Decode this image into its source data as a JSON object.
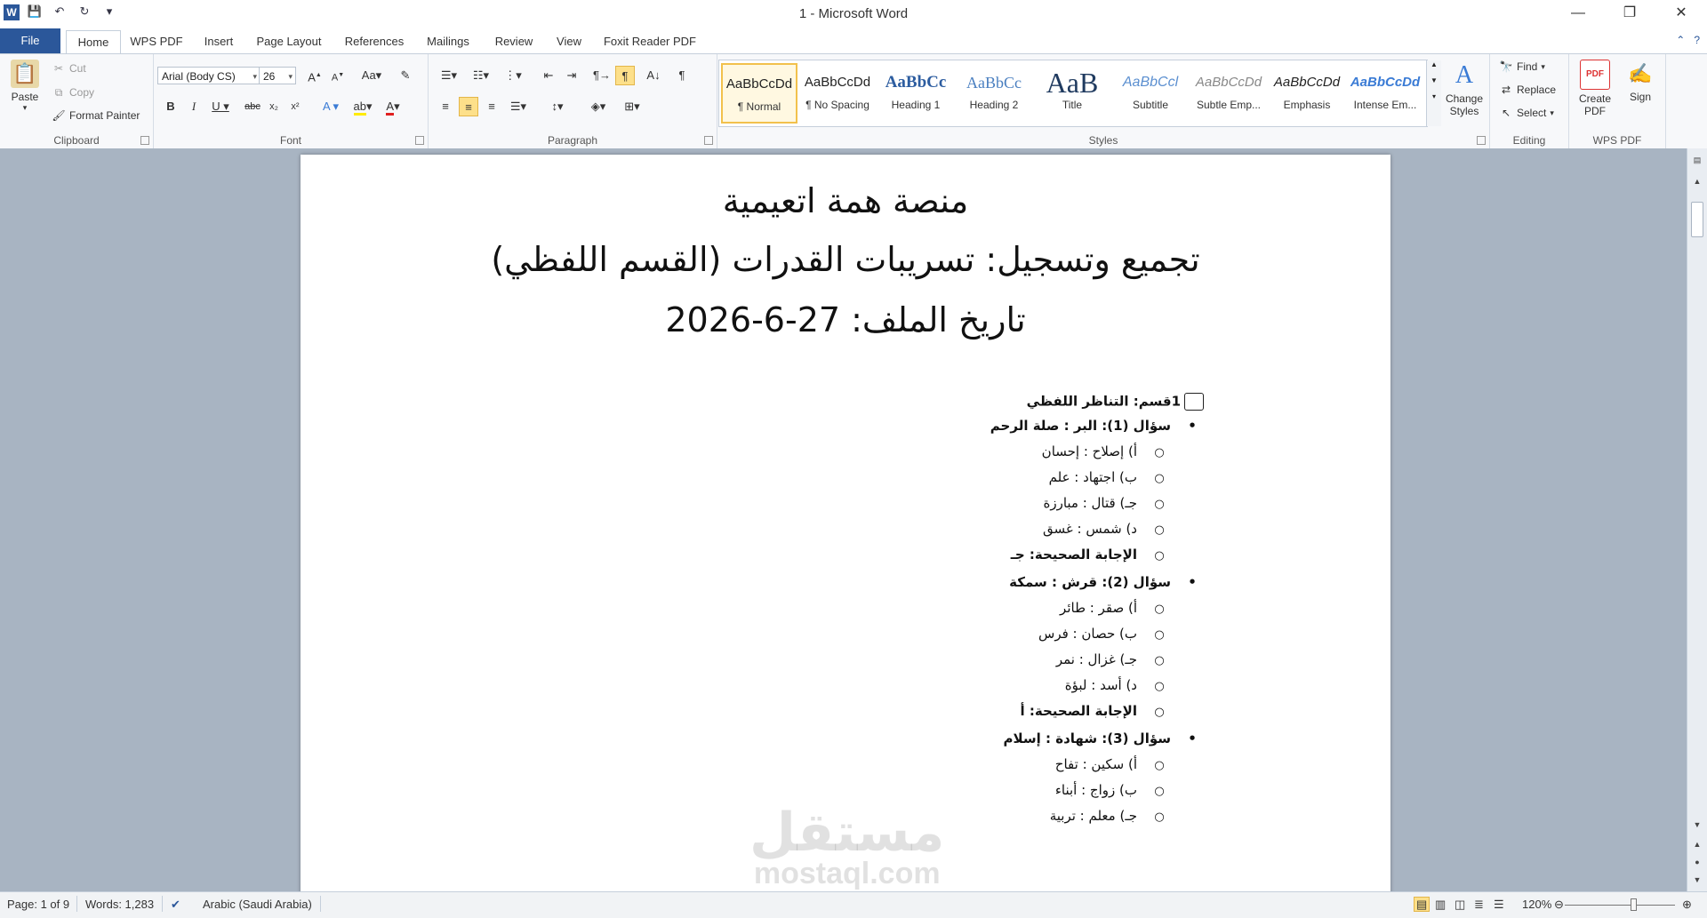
{
  "window": {
    "title": "1  -  Microsoft Word",
    "app_icon": "W",
    "controls": [
      "—",
      "❐",
      "✕"
    ]
  },
  "qat": {
    "save": "💾",
    "undo": "↶",
    "redo": "↻",
    "customize": "▾"
  },
  "tabs": [
    {
      "label": "File"
    },
    {
      "label": "Home"
    },
    {
      "label": "WPS PDF"
    },
    {
      "label": "Insert"
    },
    {
      "label": "Page Layout"
    },
    {
      "label": "References"
    },
    {
      "label": "Mailings"
    },
    {
      "label": "Review"
    },
    {
      "label": "View"
    },
    {
      "label": "Foxit Reader PDF"
    }
  ],
  "ribbon": {
    "clipboard": {
      "label": "Clipboard",
      "paste": "Paste",
      "cut": "Cut",
      "copy": "Copy",
      "format_painter": "Format Painter"
    },
    "font": {
      "label": "Font",
      "font_name": "Arial (Body CS)",
      "font_size": "26"
    },
    "paragraph": {
      "label": "Paragraph"
    },
    "styles": {
      "label": "Styles",
      "items": [
        {
          "preview": "AaBbCcDd",
          "name": "¶ Normal"
        },
        {
          "preview": "AaBbCcDd",
          "name": "¶ No Spacing"
        },
        {
          "preview": "AaBbCc",
          "name": "Heading 1"
        },
        {
          "preview": "AaBbCc",
          "name": "Heading 2"
        },
        {
          "preview": "AaB",
          "name": "Title"
        },
        {
          "preview": "AaBbCcl",
          "name": "Subtitle"
        },
        {
          "preview": "AaBbCcDd",
          "name": "Subtle Emp..."
        },
        {
          "preview": "AaBbCcDd",
          "name": "Emphasis"
        },
        {
          "preview": "AaBbCcDd",
          "name": "Intense Em..."
        }
      ],
      "change_styles": "Change Styles"
    },
    "editing": {
      "label": "Editing",
      "find": "Find",
      "replace": "Replace",
      "select": "Select"
    },
    "wps_pdf": {
      "label": "WPS PDF",
      "create_pdf": "Create PDF",
      "sign": "Sign"
    }
  },
  "document": {
    "heading_lines": [
      "منصة همة اتعيمية",
      "تجميع وتسجيل: تسريبات القدرات (القسم اللفظي)",
      "تاريخ الملف: 27-6-2026"
    ],
    "section_title": "1قسم: التناظر اللفظي",
    "questions": [
      {
        "title": "سؤال (1): البر : صلة الرحم",
        "options": [
          "أ) إصلاح : إحسان",
          "ب) اجتهاد : علم",
          "جـ) قتال : مبارزة",
          "د) شمس : غسق"
        ],
        "answer": "الإجابة الصحيحة: جـ"
      },
      {
        "title": "سؤال (2): قرش : سمكة",
        "options": [
          "أ) صقر : طائر",
          "ب) حصان : فرس",
          "جـ) غزال : نمر",
          "د) أسد : لبؤة"
        ],
        "answer": "الإجابة الصحيحة: أ"
      },
      {
        "title": "سؤال (3): شهادة : إسلام",
        "options": [
          "أ) سكين : تفاح",
          "ب) زواج : أبناء",
          "جـ) معلم : تربية"
        ]
      }
    ],
    "watermark": {
      "arabic": "مستقل",
      "latin": "mostaql.com"
    }
  },
  "statusbar": {
    "page": "Page: 1 of 9",
    "words": "Words: 1,283",
    "language": "Arabic (Saudi Arabia)",
    "zoom": "120%",
    "zoom_level": 1.2
  }
}
